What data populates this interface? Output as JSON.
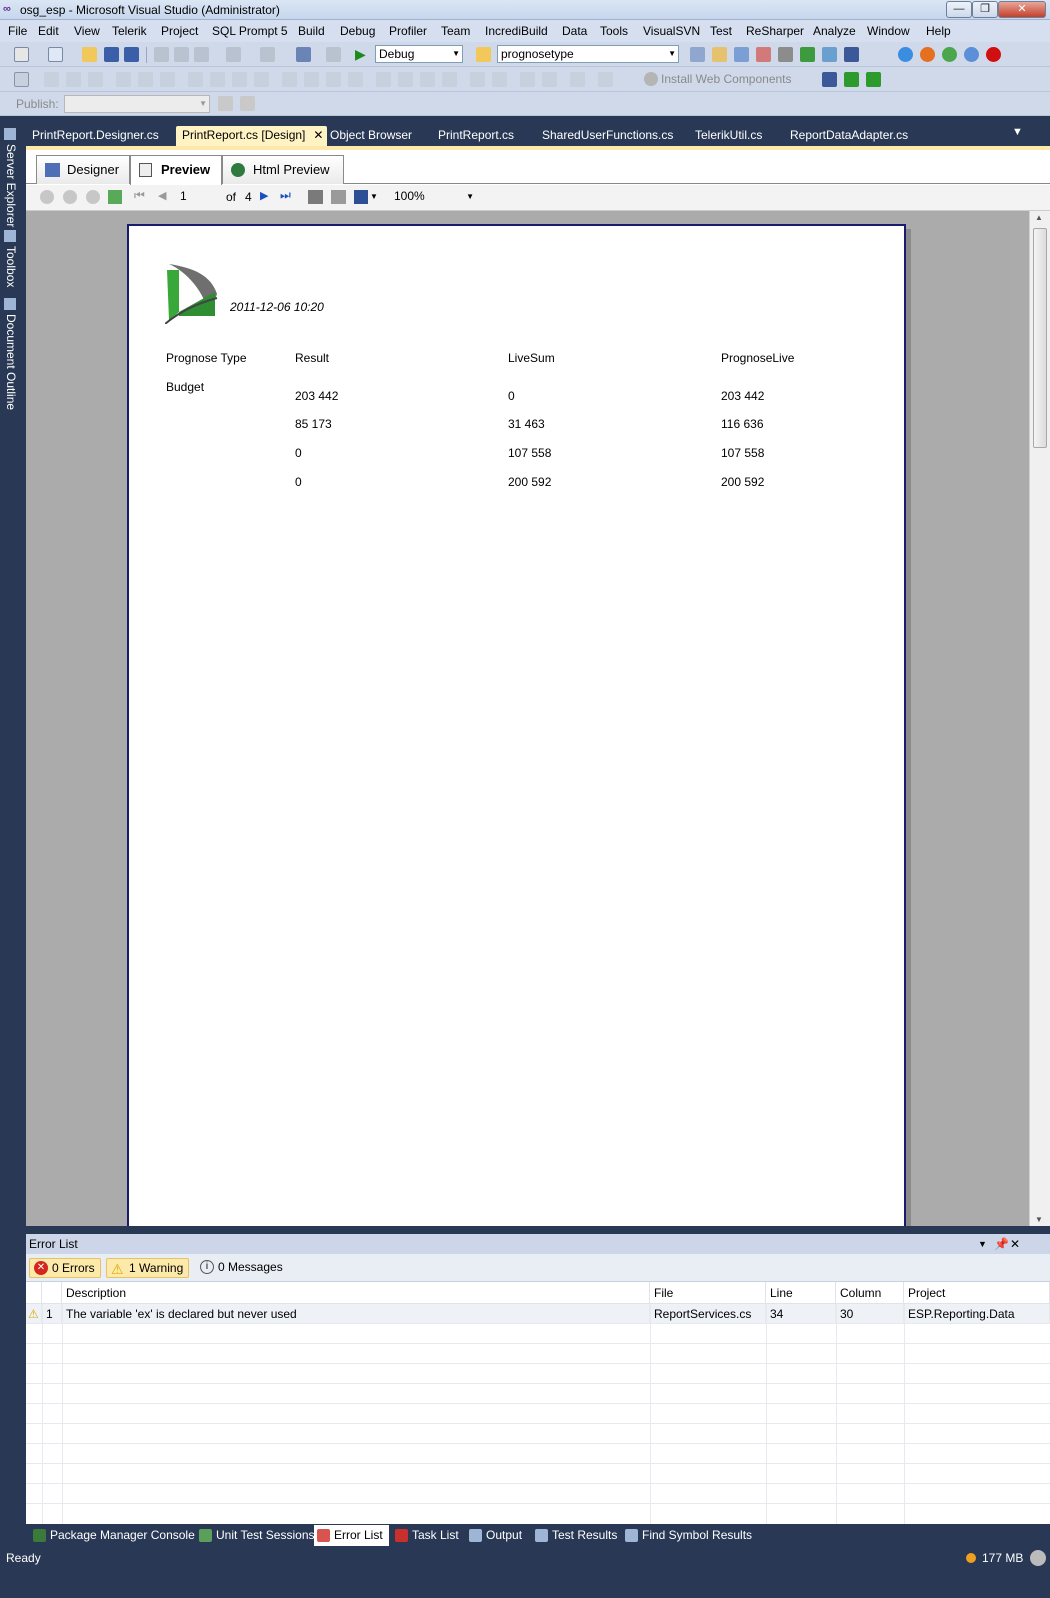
{
  "window": {
    "title": "osg_esp - Microsoft Visual Studio (Administrator)"
  },
  "menu": [
    "File",
    "Edit",
    "View",
    "Telerik",
    "Project",
    "SQL Prompt 5",
    "Build",
    "Debug",
    "Profiler",
    "Team",
    "IncrediBuild",
    "Data",
    "Tools",
    "VisualSVN",
    "Test",
    "ReSharper",
    "Analyze",
    "Window",
    "Help"
  ],
  "toolbar": {
    "config": "Debug",
    "find_value": "prognosetype",
    "install_web_components": "Install Web Components",
    "publish_label": "Publish:"
  },
  "side_tabs": [
    "Server Explorer",
    "Toolbox",
    "Document Outline"
  ],
  "doc_tabs": [
    "PrintReport.Designer.cs",
    "PrintReport.cs [Design]",
    "Object Browser",
    "PrintReport.cs",
    "SharedUserFunctions.cs",
    "TelerikUtil.cs",
    "ReportDataAdapter.cs"
  ],
  "inner_tabs": [
    "Designer",
    "Preview",
    "Html Preview"
  ],
  "report_viewer": {
    "page": "1",
    "of_label": "of",
    "total_pages": "4",
    "zoom": "100%"
  },
  "report": {
    "timestamp": "2011-12-06 10:20",
    "headers": [
      "Prognose Type",
      "Result",
      "LiveSum",
      "PrognoseLive"
    ],
    "group": "Budget",
    "rows": [
      [
        "203 442",
        "0",
        "203 442"
      ],
      [
        "85 173",
        "31 463",
        "116 636"
      ],
      [
        "0",
        "107 558",
        "107 558"
      ],
      [
        "0",
        "200 592",
        "200 592"
      ]
    ]
  },
  "error_list": {
    "title": "Error List",
    "filters": {
      "errors": "0 Errors",
      "warnings": "1 Warning",
      "messages": "0 Messages"
    },
    "columns": [
      "Description",
      "File",
      "Line",
      "Column",
      "Project"
    ],
    "items": [
      {
        "num": "1",
        "description": "The variable 'ex' is declared but never used",
        "file": "ReportServices.cs",
        "line": "34",
        "column": "30",
        "project": "ESP.Reporting.Data"
      }
    ]
  },
  "bottom_tabs": [
    "Package Manager Console",
    "Unit Test Sessions",
    "Error List",
    "Task List",
    "Output",
    "Test Results",
    "Find Symbol Results"
  ],
  "status": {
    "text": "Ready",
    "memory": "177 MB"
  }
}
